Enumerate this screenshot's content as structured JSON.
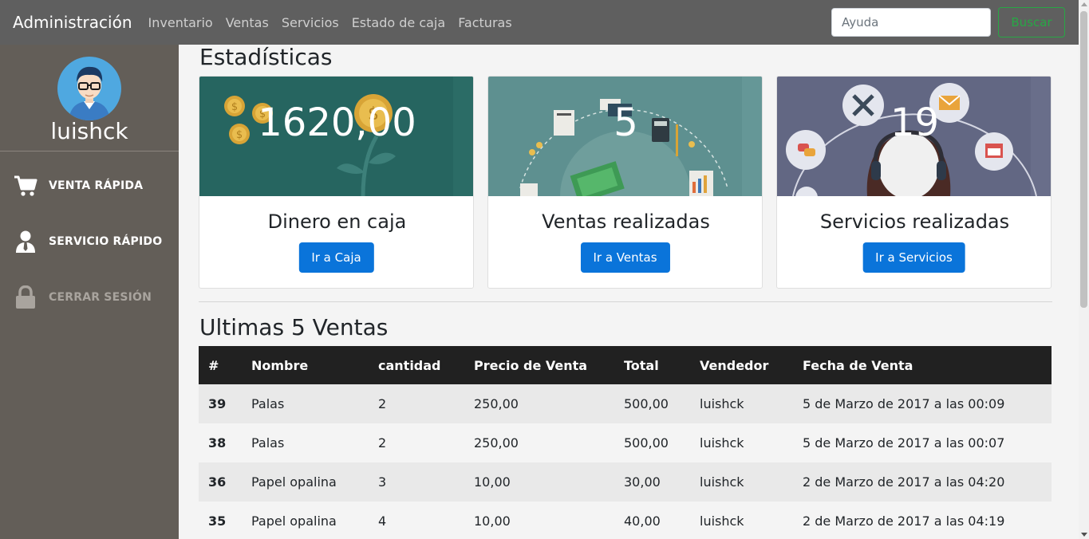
{
  "navbar": {
    "brand": "Administración",
    "links": [
      "Inventario",
      "Ventas",
      "Servicios",
      "Estado de caja",
      "Facturas"
    ],
    "search_placeholder": "Ayuda",
    "search_button": "Buscar"
  },
  "sidebar": {
    "username": "luishck",
    "items": [
      {
        "label": "VENTA RÁPIDA",
        "icon": "cart-icon"
      },
      {
        "label": "SERVICIO RÁPIDO",
        "icon": "user-tie-icon"
      },
      {
        "label": "CERRAR SESIÓN",
        "icon": "lock-icon"
      }
    ]
  },
  "stats": {
    "title": "Estadísticas",
    "cards": [
      {
        "value": "1620,00",
        "title": "Dinero en caja",
        "button": "Ir a Caja",
        "color": "#266560"
      },
      {
        "value": "5",
        "title": "Ventas realizadas",
        "button": "Ir a Ventas",
        "color": "#5e9090"
      },
      {
        "value": "19",
        "title": "Servicios realizadas",
        "button": "Ir a Servicios",
        "color": "#626783"
      }
    ]
  },
  "sales": {
    "title": "Ultimas 5 Ventas",
    "headers": [
      "#",
      "Nombre",
      "cantidad",
      "Precio de Venta",
      "Total",
      "Vendedor",
      "Fecha de Venta"
    ],
    "rows": [
      [
        "39",
        "Palas",
        "2",
        "250,00",
        "500,00",
        "luishck",
        "5 de Marzo de 2017 a las 00:09"
      ],
      [
        "38",
        "Palas",
        "2",
        "250,00",
        "500,00",
        "luishck",
        "5 de Marzo de 2017 a las 00:07"
      ],
      [
        "36",
        "Papel opalina",
        "3",
        "10,00",
        "30,00",
        "luishck",
        "2 de Marzo de 2017 a las 04:20"
      ],
      [
        "35",
        "Papel opalina",
        "4",
        "10,00",
        "40,00",
        "luishck",
        "2 de Marzo de 2017 a las 04:19"
      ]
    ]
  },
  "colors": {
    "navbar": "#5f5f5f",
    "sidebar": "#635e58",
    "primary": "#0a74da",
    "success": "#28a745",
    "table_header": "#212121"
  }
}
